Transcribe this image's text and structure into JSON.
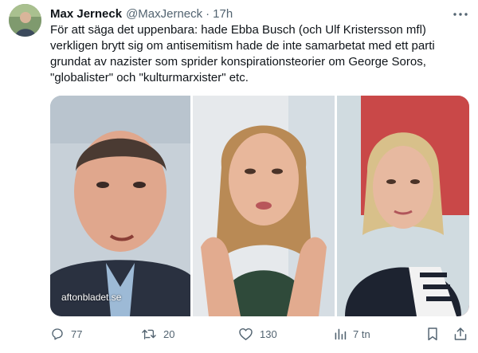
{
  "author": {
    "name": "Max Jerneck",
    "handle": "@MaxJerneck",
    "separator": "·",
    "time": "17h"
  },
  "tweet": {
    "text": "För att säga det uppenbara: hade Ebba Busch (och Ulf Kristersson mfl) verkligen brytt sig om antisemitism hade de inte samarbetat med ett parti grundat av nazister som sprider konspirationsteorier om George Soros, \"globalister\" och \"kulturmarxister\" etc."
  },
  "media": {
    "watermark": "aftonbladet.se"
  },
  "actions": {
    "reply_count": "77",
    "retweet_count": "20",
    "like_count": "130",
    "views_count": "7 tn"
  },
  "colors": {
    "text_primary": "#0f1419",
    "text_secondary": "#536471",
    "background": "#ffffff"
  },
  "icons": {
    "more": "more-dots-icon",
    "reply": "reply-icon",
    "retweet": "retweet-icon",
    "like": "heart-icon",
    "views": "views-chart-icon",
    "bookmark": "bookmark-icon",
    "share": "share-icon"
  }
}
